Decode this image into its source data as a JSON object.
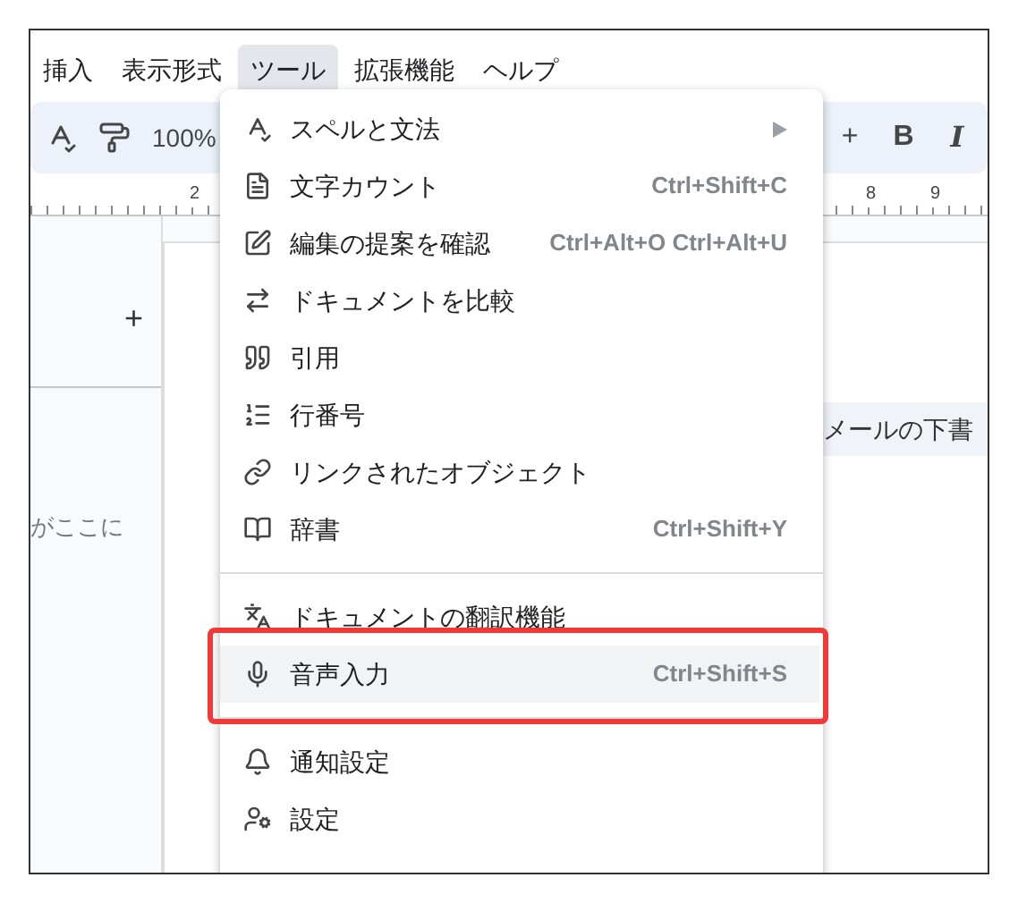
{
  "menu_bar": [
    {
      "label": "挿入",
      "selected": false
    },
    {
      "label": "表示形式",
      "selected": false
    },
    {
      "label": "ツール",
      "selected": true
    },
    {
      "label": "拡張機能",
      "selected": false
    },
    {
      "label": "ヘルプ",
      "selected": false
    }
  ],
  "toolbar": {
    "zoom": "100%",
    "right_buttons": [
      "+",
      "B",
      "I"
    ]
  },
  "ruler": {
    "labels": [
      "2",
      "8",
      "9"
    ]
  },
  "sidebar": {
    "add": "+",
    "placeholder_text": "がここに"
  },
  "document": {
    "chip_text": "メールの下書"
  },
  "tools_menu": [
    {
      "kind": "item",
      "label": "スペルと文法",
      "submenu": true,
      "highlighted": false,
      "annotated": false
    },
    {
      "kind": "item",
      "label": "文字カウント",
      "shortcut": "Ctrl+Shift+C",
      "submenu": false,
      "highlighted": false,
      "annotated": false
    },
    {
      "kind": "item",
      "label": "編集の提案を確認",
      "shortcut": "Ctrl+Alt+O Ctrl+Alt+U",
      "submenu": false,
      "highlighted": false,
      "annotated": false
    },
    {
      "kind": "item",
      "label": "ドキュメントを比較",
      "submenu": false,
      "highlighted": false,
      "annotated": false
    },
    {
      "kind": "item",
      "label": "引用",
      "submenu": false,
      "highlighted": false,
      "annotated": false
    },
    {
      "kind": "item",
      "label": "行番号",
      "submenu": false,
      "highlighted": false,
      "annotated": false
    },
    {
      "kind": "item",
      "label": "リンクされたオブジェクト",
      "submenu": false,
      "highlighted": false,
      "annotated": false
    },
    {
      "kind": "item",
      "label": "辞書",
      "shortcut": "Ctrl+Shift+Y",
      "submenu": false,
      "highlighted": false,
      "annotated": false
    },
    {
      "kind": "divider"
    },
    {
      "kind": "item",
      "label": "ドキュメントの翻訳機能",
      "submenu": false,
      "highlighted": false,
      "annotated": false
    },
    {
      "kind": "item",
      "label": "音声入力",
      "shortcut": "Ctrl+Shift+S",
      "submenu": false,
      "highlighted": true,
      "annotated": true
    },
    {
      "kind": "divider"
    },
    {
      "kind": "item",
      "label": "通知設定",
      "submenu": false,
      "highlighted": false,
      "annotated": false
    },
    {
      "kind": "item",
      "label": "設定",
      "submenu": false,
      "highlighted": false,
      "annotated": false
    }
  ]
}
